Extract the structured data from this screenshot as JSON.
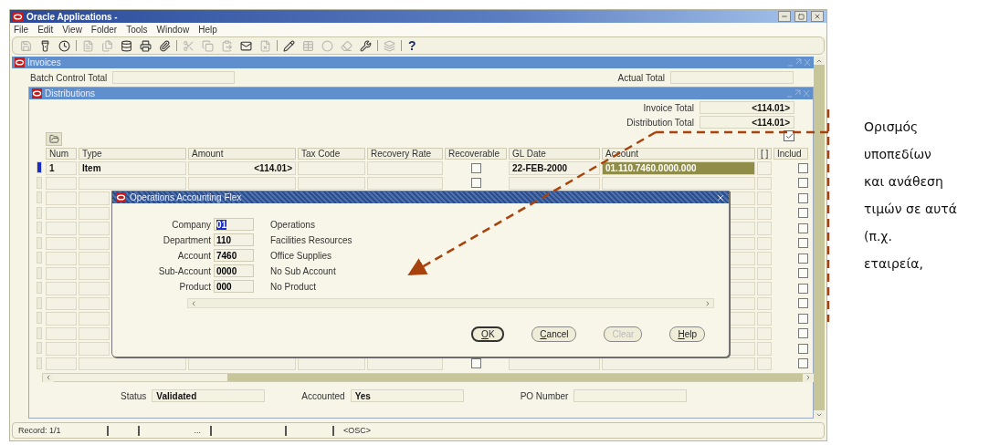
{
  "window": {
    "title": "Oracle Applications -"
  },
  "menu": [
    {
      "label": "File"
    },
    {
      "label": "Edit"
    },
    {
      "label": "View"
    },
    {
      "label": "Folder"
    },
    {
      "label": "Tools"
    },
    {
      "label": "Window"
    },
    {
      "label": "Help"
    }
  ],
  "toolbar": [
    {
      "kind": "new",
      "enabled": false
    },
    {
      "kind": "find",
      "enabled": true
    },
    {
      "kind": "history",
      "enabled": true
    },
    {
      "kind": "separator"
    },
    {
      "kind": "document",
      "enabled": false
    },
    {
      "kind": "files",
      "enabled": false
    },
    {
      "kind": "database",
      "enabled": true
    },
    {
      "kind": "print",
      "enabled": true
    },
    {
      "kind": "attach",
      "enabled": true
    },
    {
      "kind": "separator"
    },
    {
      "kind": "cut",
      "enabled": false
    },
    {
      "kind": "copy",
      "enabled": false
    },
    {
      "kind": "paste",
      "enabled": false
    },
    {
      "kind": "mail",
      "enabled": true
    },
    {
      "kind": "delete",
      "enabled": false
    },
    {
      "kind": "separator"
    },
    {
      "kind": "edit",
      "enabled": true
    },
    {
      "kind": "table",
      "enabled": false
    },
    {
      "kind": "circle",
      "enabled": false
    },
    {
      "kind": "eraser",
      "enabled": false
    },
    {
      "kind": "tools",
      "enabled": true
    },
    {
      "kind": "separator"
    },
    {
      "kind": "layers",
      "enabled": false
    },
    {
      "kind": "separator"
    },
    {
      "kind": "help",
      "enabled": true,
      "label": "?"
    }
  ],
  "invoices": {
    "title": "Invoices",
    "batch_control_total": {
      "label": "Batch Control Total"
    },
    "actual_total": {
      "label": "Actual Total"
    }
  },
  "distributions": {
    "title": "Distributions",
    "invoice_total": {
      "label": "Invoice Total",
      "value": "<114.01>"
    },
    "distribution_total": {
      "label": "Distribution Total",
      "value": "<114.01>"
    },
    "checkbox_1": {
      "checked": true
    },
    "columns": [
      "Num",
      "Type",
      "Amount",
      "Tax Code",
      "Recovery Rate",
      "Recoverable",
      "GL Date",
      "Account",
      "[ ]",
      "Includ"
    ],
    "rows": [
      {
        "selected": true,
        "num": "1",
        "type": "Item",
        "amount": "<114.01>",
        "recoverable": false,
        "gl_date": "22-FEB-2000",
        "account": "01.110.7460.0000.000",
        "include": false
      },
      {
        "selected": false,
        "recoverable": false,
        "include": false
      },
      {
        "selected": false,
        "include": false
      },
      {
        "selected": false,
        "include": false
      },
      {
        "selected": false,
        "include": false
      },
      {
        "selected": false,
        "include": false
      },
      {
        "selected": false,
        "include": false
      },
      {
        "selected": false,
        "include": false
      },
      {
        "selected": false,
        "include": false
      },
      {
        "selected": false,
        "include": false
      },
      {
        "selected": false,
        "include": false
      },
      {
        "selected": false,
        "include": false
      },
      {
        "selected": false,
        "include": false
      },
      {
        "selected": false,
        "recoverable": false,
        "include": false
      }
    ],
    "status": {
      "label": "Status",
      "value": "Validated"
    },
    "accounted": {
      "label": "Accounted",
      "value": "Yes"
    },
    "po_number": {
      "label": "PO Number"
    }
  },
  "dialog": {
    "title": "Operations Accounting Flex",
    "segments": [
      {
        "label": "Company",
        "value": "01",
        "description": "Operations",
        "selected": true
      },
      {
        "label": "Department",
        "value": "110",
        "description": "Facilities Resources",
        "selected": false
      },
      {
        "label": "Account",
        "value": "7460",
        "description": "Office Supplies",
        "selected": false
      },
      {
        "label": "Sub-Account",
        "value": "0000",
        "description": "No Sub Account",
        "selected": false
      },
      {
        "label": "Product",
        "value": "000",
        "description": "No Product",
        "selected": false
      }
    ],
    "buttons": [
      {
        "label": "OK",
        "default": true,
        "disabled": false
      },
      {
        "label": "Cancel",
        "default": false,
        "disabled": false
      },
      {
        "label": "Clear",
        "default": false,
        "disabled": true
      },
      {
        "label": "Help",
        "default": false,
        "disabled": false
      }
    ]
  },
  "status_bar": {
    "record": "Record: 1/1",
    "ellipsis": "...",
    "mode": "<OSC>"
  },
  "annotation": {
    "lines": [
      "Ορισμός",
      "υποπεδίων",
      "και ανάθεση",
      "τιμών σε αυτά",
      "(π.χ.",
      "εταιρεία,"
    ]
  }
}
